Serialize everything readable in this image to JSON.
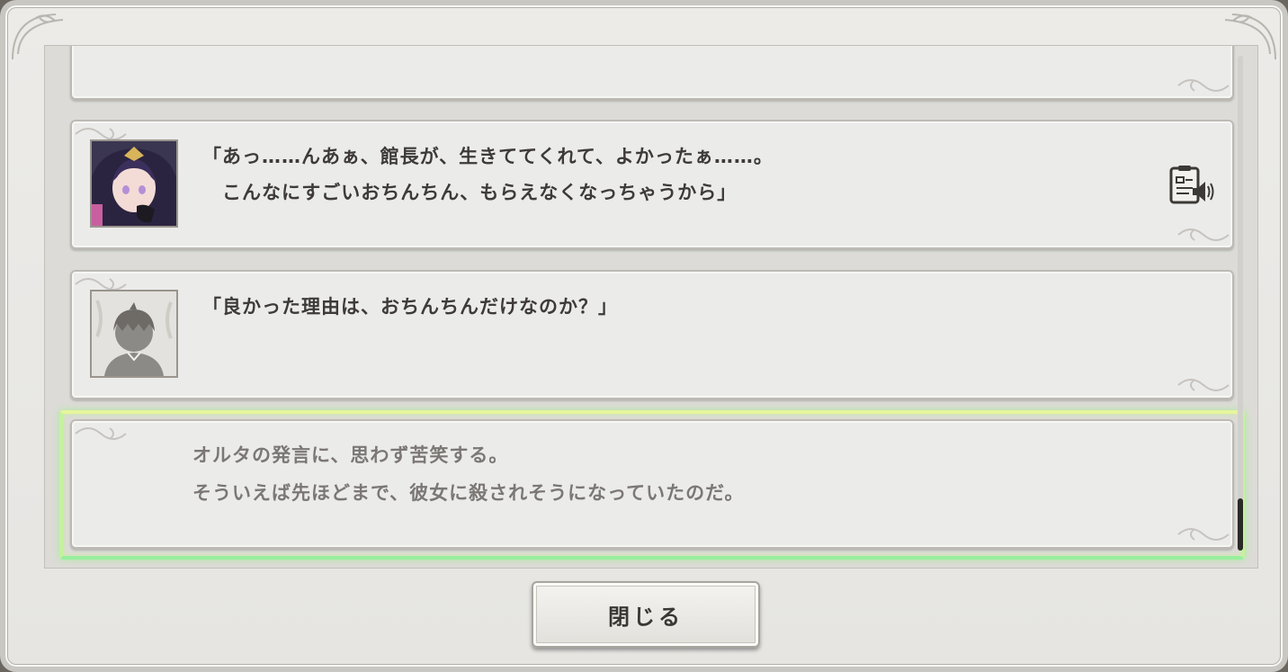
{
  "backlog": {
    "entries": [
      {
        "speaker_icon": "character-portrait",
        "lines": [
          "「あっ……んあぁ、館長が、生きててくれて、よかったぁ……。",
          "　こんなにすごいおちんちん、もらえなくなっちゃうから」"
        ],
        "voice_icon": "voice-replay-icon"
      },
      {
        "speaker_icon": "protagonist-silhouette",
        "lines": [
          "「良かった理由は、おちんちんだけなのか？」"
        ]
      },
      {
        "speaker_icon": null,
        "lines": [
          "オルタの発言に、思わず苦笑する。",
          "そういえば先ほどまで、彼女に殺されそうになっていたのだ。"
        ]
      }
    ]
  },
  "close_button": {
    "label": "閉じる"
  },
  "colors": {
    "panel": "#ebebea",
    "highlight_top": "#e6f59c",
    "highlight_bottom": "#98ee9e",
    "text_dialogue": "#3d3a38",
    "text_narration": "#7b7774"
  }
}
